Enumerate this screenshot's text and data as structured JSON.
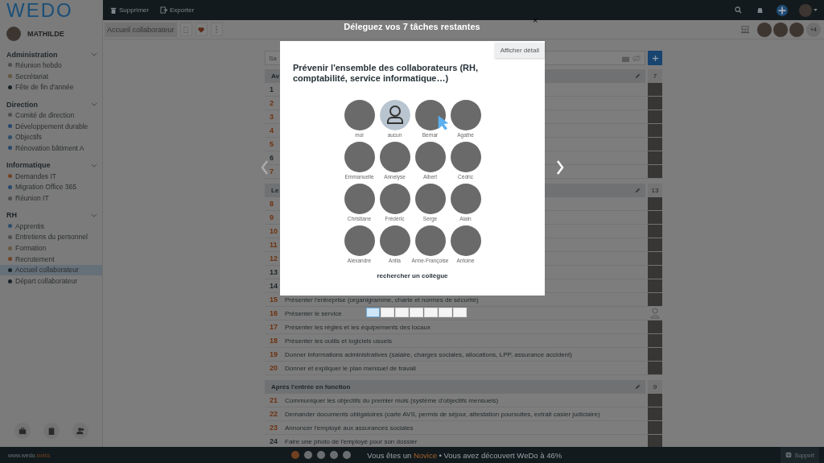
{
  "logo": {
    "text": "WEDO"
  },
  "user": {
    "name": "MATHILDE"
  },
  "sidebar": {
    "groups": [
      {
        "title": "Administration",
        "expanded": true,
        "items": [
          {
            "label": "Réunion hebdo",
            "color": "#4f4f4f",
            "selected": false
          },
          {
            "label": "Secrétariat",
            "color": "#64583f",
            "selected": false
          },
          {
            "label": "Fête de fin d'année",
            "color": "#1c2428",
            "selected": false
          }
        ]
      },
      {
        "title": "Direction",
        "expanded": true,
        "items": [
          {
            "label": "Comité de direction",
            "color": "#4f4f4f",
            "selected": false
          },
          {
            "label": "Développement durable",
            "color": "#27486a",
            "selected": false
          },
          {
            "label": "Objectifs",
            "color": "#2e4e6b",
            "selected": false
          },
          {
            "label": "Rénovation bâtiment A",
            "color": "#27486a",
            "selected": false
          }
        ]
      },
      {
        "title": "Informatique",
        "expanded": true,
        "items": [
          {
            "label": "Demandes IT",
            "color": "#704425",
            "selected": false
          },
          {
            "label": "Migration Office 365",
            "color": "#27486a",
            "selected": false
          },
          {
            "label": "Réunion IT",
            "color": "#4f4f4f",
            "selected": false
          }
        ]
      },
      {
        "title": "RH",
        "expanded": true,
        "items": [
          {
            "label": "Apprentis",
            "color": "#2e4e6b",
            "selected": false
          },
          {
            "label": "Entretiens du personnel",
            "color": "#4f4f4f",
            "selected": false
          },
          {
            "label": "Formation",
            "color": "#64583f",
            "selected": false
          },
          {
            "label": "Recrutement",
            "color": "#704425",
            "selected": false
          },
          {
            "label": "Accueil collaborateur",
            "color": "#1c2428",
            "selected": true
          },
          {
            "label": "Départ collaborateur",
            "color": "#1c2428",
            "selected": false
          }
        ]
      }
    ],
    "footer_buttons": [
      {
        "kind": "briefcase"
      },
      {
        "kind": "clipboard"
      },
      {
        "kind": "people"
      }
    ]
  },
  "toolbar": {
    "actions": [
      {
        "kind": "delete",
        "label": "Supprimer"
      },
      {
        "kind": "export",
        "label": "Exporter"
      }
    ]
  },
  "subtoolbar": {
    "tab": "Accueil collaborateur",
    "members_more": "+4"
  },
  "list": {
    "search": {
      "placeholder": "Sa"
    },
    "sections": [
      {
        "title": "Av",
        "count": "7",
        "rows": [
          {
            "number": "1",
            "color": "#1e272b",
            "assignee": {
              "kind": "photo"
            }
          },
          {
            "number": "2",
            "color": "#6e3210",
            "assignee": {
              "kind": "photo"
            }
          },
          {
            "number": "3",
            "color": "#6e3210",
            "assignee": {
              "kind": "photo"
            }
          },
          {
            "number": "4",
            "color": "#6e3210",
            "assignee": {
              "kind": "photo"
            }
          },
          {
            "number": "5",
            "color": "#6e3210",
            "assignee": {
              "kind": "photo"
            }
          },
          {
            "number": "6",
            "color": "#1e272b",
            "assignee": {
              "kind": "photo"
            }
          },
          {
            "number": "7",
            "color": "#6e3210",
            "assignee": {
              "kind": "photo"
            }
          }
        ]
      },
      {
        "title": "Le",
        "count": "13",
        "rows": [
          {
            "number": "8",
            "color": "#6e3210",
            "assignee": {
              "kind": "photo"
            }
          },
          {
            "number": "9",
            "color": "#6e3210",
            "assignee": {
              "kind": "photo"
            }
          },
          {
            "number": "10",
            "color": "#6e3210",
            "assignee": {
              "kind": "photo"
            }
          },
          {
            "number": "11",
            "color": "#6e3210",
            "assignee": {
              "kind": "photo"
            }
          },
          {
            "number": "12",
            "color": "#6e3210",
            "assignee": {
              "kind": "photo"
            }
          },
          {
            "number": "13",
            "color": "#1e272b",
            "assignee": {
              "kind": "photo"
            }
          },
          {
            "number": "14",
            "color": "#1e272b",
            "assignee": {
              "kind": "photo"
            }
          },
          {
            "number": "15",
            "color": "#6e3210",
            "text": "Présenter l'entreprise (organigramme, charte et normes de sécurité)",
            "assignee": {
              "kind": "photo"
            }
          },
          {
            "number": "16",
            "color": "#6e3210",
            "text": "Présenter le service",
            "assignee": {
              "kind": "none"
            }
          },
          {
            "number": "17",
            "color": "#6e3210",
            "text": "Présenter les règles et les équipements des locaux",
            "assignee": {
              "kind": "photo"
            }
          },
          {
            "number": "18",
            "color": "#6e3210",
            "text": "Présenter les outils et logiciels usuels",
            "assignee": {
              "kind": "photo"
            }
          },
          {
            "number": "19",
            "color": "#6e3210",
            "text": "Donner informations administratives (salaire, charges sociales, allocations, LPP, assurance accident)",
            "assignee": {
              "kind": "photo"
            }
          },
          {
            "number": "20",
            "color": "#6e3210",
            "text": "Donner et expliquer le plan mensuel de travail",
            "assignee": {
              "kind": "photo"
            }
          }
        ]
      },
      {
        "title": "Après l'entrée en fonction",
        "count": "9",
        "rows": [
          {
            "number": "21",
            "color": "#6e3210",
            "text": "Communiquer les objectifs du premier mois (système d'objectifs mensuels)",
            "assignee": {
              "kind": "photo"
            }
          },
          {
            "number": "22",
            "color": "#6e3210",
            "text": "Demander documents obligatoires (carte AVS, permis de séjour, attestation poursuites, extrait casier judiciaire)",
            "assignee": {
              "kind": "photo"
            }
          },
          {
            "number": "23",
            "color": "#6e3210",
            "text": "Annoncer l'employé aux assurances sociales",
            "assignee": {
              "kind": "photo"
            }
          },
          {
            "number": "24",
            "color": "#1e272b",
            "text": "Faire une photo de l'employé pour son dossier",
            "assignee": {
              "kind": "photo"
            }
          }
        ]
      }
    ]
  },
  "modal": {
    "heading": "Déleguez vos 7 tâches restantes",
    "close": "×",
    "detail_button": "Afficher détail",
    "question": "Prévenir l'ensemble des collaborateurs (RH, comptabilité, service informatique…)",
    "people": [
      {
        "name": "moi",
        "kind": "photo"
      },
      {
        "name": "aucun",
        "kind": "none"
      },
      {
        "name": "Bernar",
        "kind": "photo"
      },
      {
        "name": "Agathe",
        "kind": "photo"
      },
      {
        "name": "Emmanuelle",
        "kind": "photo"
      },
      {
        "name": "Annelyse",
        "kind": "photo"
      },
      {
        "name": "Albert",
        "kind": "photo"
      },
      {
        "name": "Cédric",
        "kind": "photo"
      },
      {
        "name": "Christiane",
        "kind": "photo"
      },
      {
        "name": "Frédéric",
        "kind": "photo"
      },
      {
        "name": "Serge",
        "kind": "photo"
      },
      {
        "name": "Alain",
        "kind": "photo"
      },
      {
        "name": "Alexandre",
        "kind": "photo"
      },
      {
        "name": "Anita",
        "kind": "photo"
      },
      {
        "name": "Anne-Françoise",
        "kind": "photo"
      },
      {
        "name": "Antoine",
        "kind": "photo"
      }
    ],
    "search_link": "rechercher un collègue",
    "pages": [
      {
        "selected": true
      },
      {
        "selected": false
      },
      {
        "selected": false
      },
      {
        "selected": false
      },
      {
        "selected": false
      },
      {
        "selected": false
      },
      {
        "selected": false
      }
    ]
  },
  "status_bar": {
    "site": "www.wedo.",
    "site_suffix": "swiss",
    "steps": [
      {
        "done": true
      },
      {
        "done": false
      },
      {
        "done": false
      },
      {
        "done": false
      },
      {
        "done": false
      }
    ],
    "message": {
      "prefix": "Vous êtes un ",
      "highlight": "Novice",
      "suffix": " • Vous avez découvert WeDo à 46%"
    },
    "support": "Support"
  }
}
